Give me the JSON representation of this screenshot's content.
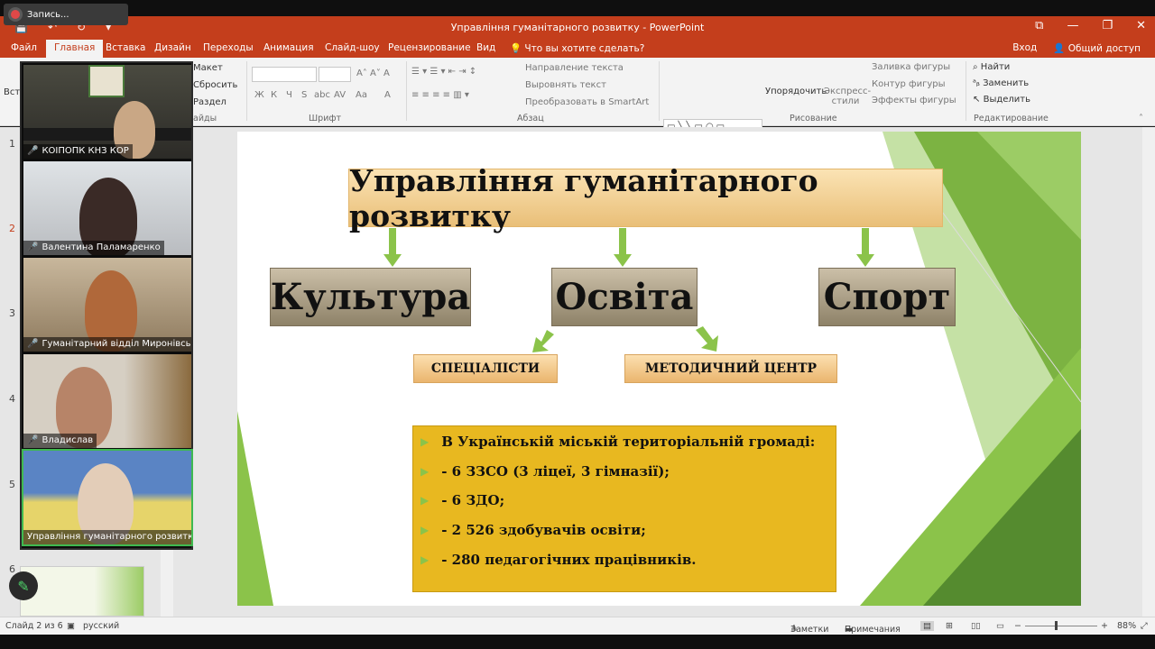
{
  "recording": {
    "label": "Запись..."
  },
  "window": {
    "title": "Управління гуманітарного розвитку - PowerPoint"
  },
  "ribbon_tabs": [
    "Файл",
    "Главная",
    "Вставка",
    "Дизайн",
    "Переходы",
    "Анимация",
    "Слайд-шоу",
    "Рецензирование",
    "Вид"
  ],
  "active_tab": "Главная",
  "tell_me": "Что вы хотите сделать?",
  "account": {
    "signin": "Вход",
    "share": "Общий доступ"
  },
  "ribbon": {
    "slides": {
      "paste_partial": "Вста",
      "layout": "Макет",
      "reset": "Сбросить",
      "section": "Раздел",
      "group_partial": "айды"
    },
    "font": {
      "group": "Шрифт",
      "format_buttons": [
        "Ж",
        "К",
        "Ч",
        "S",
        "abc",
        "AV",
        "Aa",
        "A"
      ]
    },
    "paragraph": {
      "group": "Абзац",
      "text_direction": "Направление текста",
      "align_text": "Выровнять текст",
      "smartart": "Преобразовать в SmartArt"
    },
    "drawing": {
      "group": "Рисование",
      "arrange": "Упорядочить",
      "quick_styles": "Экспресс-стили",
      "fill": "Заливка фигуры",
      "outline": "Контур фигуры",
      "effects": "Эффекты фигуры"
    },
    "editing": {
      "group": "Редактирование",
      "find": "Найти",
      "replace": "Заменить",
      "select": "Выделить"
    }
  },
  "thumbnails": {
    "numbers": [
      "1",
      "2",
      "3",
      "4",
      "5",
      "6"
    ],
    "selected": "2"
  },
  "participants": [
    {
      "name": "КОІПОПК КНЗ КОР",
      "muted": true
    },
    {
      "name": "Валентина Паламаренко",
      "muted": true
    },
    {
      "name": "Гуманітарний відділ Миронівськ...",
      "muted": true
    },
    {
      "name": "Владислав",
      "muted": true
    },
    {
      "name": "Управління гуманітарного розвитку",
      "muted": false
    }
  ],
  "slide": {
    "title": "Управління гуманітарного розвитку",
    "branches": [
      "Культура",
      "Освіта",
      "Спорт"
    ],
    "sub_branches": [
      "СПЕЦІАЛІСТИ",
      "МЕТОДИЧНИЙ ЦЕНТР"
    ],
    "info": [
      "В Українській міській територіальній громаді:",
      "- 6 ЗЗСО (3 ліцеї, 3 гімназії);",
      "- 6 ЗДО;",
      "- 2 526 здобувачів освіти;",
      "- 280 педагогічних працівників."
    ]
  },
  "statusbar": {
    "slide": "Слайд 2 из 6",
    "language": "русский",
    "notes": "Заметки",
    "comments": "Примечания",
    "zoom": "88%"
  },
  "colors": {
    "accent": "#c43e1c",
    "slide_green": "#8bc34a",
    "info_box": "#e8b820"
  }
}
